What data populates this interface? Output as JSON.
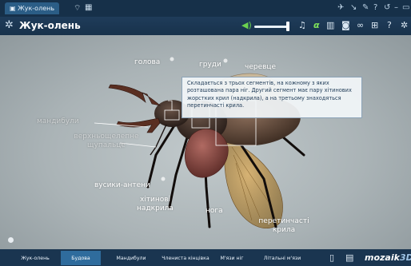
{
  "window": {
    "tab_title": "Жук-олень",
    "tab_icons": [
      "page-icon",
      "grid-icon"
    ],
    "system_icons": [
      "pin-icon",
      "arrow-icon",
      "pen-icon",
      "help-icon",
      "refresh-icon",
      "minimize-icon",
      "maximize-icon"
    ]
  },
  "titlebar": {
    "title": "Жук-олень",
    "toolbar_icons": [
      "speaker-icon",
      "music-icon",
      "alpha-icon",
      "book-icon",
      "camera-icon",
      "link-icon",
      "grid-icon",
      "help-icon",
      "gear-icon"
    ],
    "alpha_glyph": "α",
    "volume_level": 0.95
  },
  "scene": {
    "labels": {
      "head": "голова",
      "thorax": "груди",
      "abdomen": "черевце",
      "mandibles": "мандибули",
      "maxillary_palps": "верхньощелепне щупальце",
      "antennae": "вусики-антени",
      "elytra": "хітинові надкрила",
      "leg": "нога",
      "hind_wings": "перетинчасті крила"
    },
    "tooltip": "Складається з трьох сегментів, на кожному з яких розташована пара ніг. Другий сегмент має пару хітинових жорстких крил (надкрила), а на третьому знаходяться перетинчасті крила."
  },
  "bottom_tabs": [
    {
      "label": "Жук-олень",
      "active": false
    },
    {
      "label": "Будова",
      "active": true
    },
    {
      "label": "Мандибули",
      "active": false
    },
    {
      "label": "Членистa кінцівка",
      "active": false
    },
    {
      "label": "М'язи ніг",
      "active": false
    },
    {
      "label": "Літальні м'язи",
      "active": false
    }
  ],
  "bottom_icons": [
    "document-icon",
    "save-icon"
  ],
  "logo": {
    "text": "mozaik",
    "suffix": "3D"
  }
}
